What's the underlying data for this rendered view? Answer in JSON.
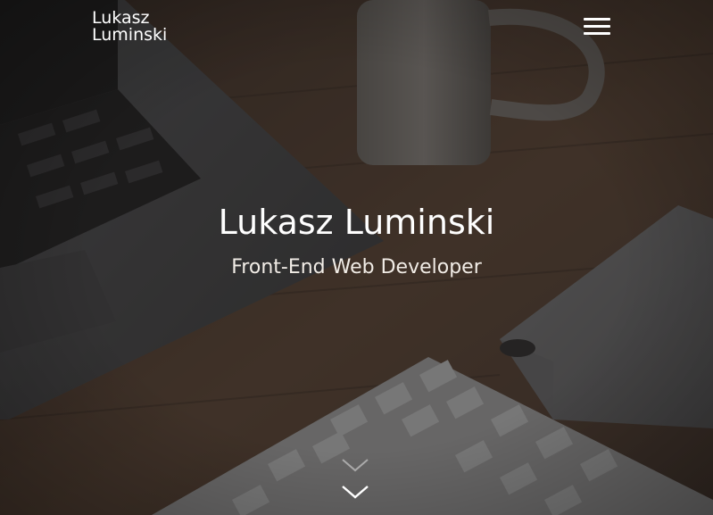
{
  "header": {
    "logo_line1": "Lukasz",
    "logo_line2": "Luminski",
    "menu_icon": "hamburger-menu-icon"
  },
  "hero": {
    "title": "Lukasz Luminski",
    "subtitle": "Front-End Web Developer",
    "scroll_icon": "double-chevron-down-icon"
  },
  "colors": {
    "text": "#ffffff",
    "background_desk": "#5a4638",
    "overlay": "#1b1714"
  }
}
